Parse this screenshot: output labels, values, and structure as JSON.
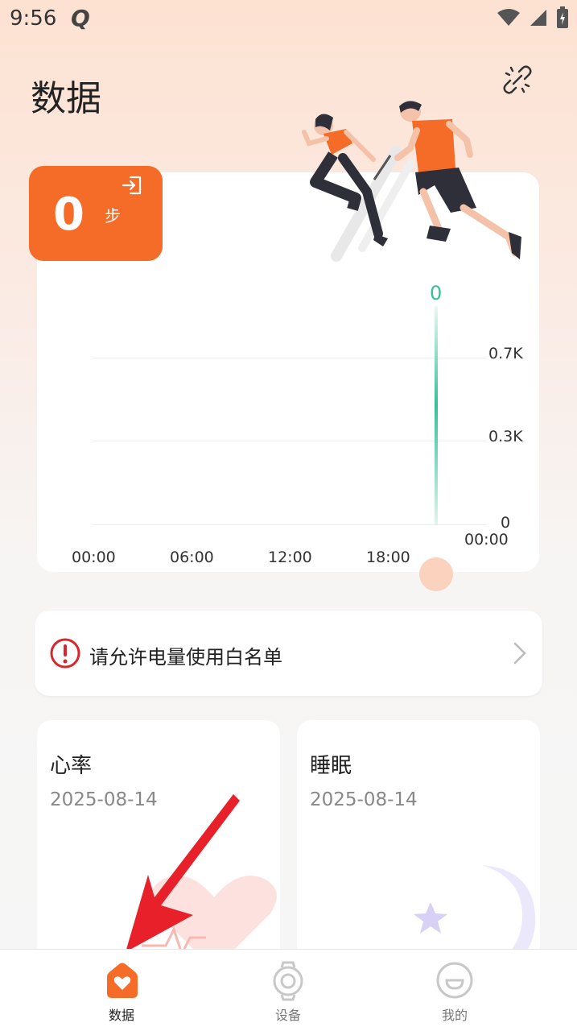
{
  "status": {
    "time": "9:56",
    "carrier_glyph": "Q"
  },
  "header": {
    "title": "数据"
  },
  "steps": {
    "value": "0",
    "unit": "步"
  },
  "chart_data": {
    "type": "bar",
    "x_ticks": [
      "00:00",
      "06:00",
      "12:00",
      "18:00",
      "00:00"
    ],
    "y_ticks": [
      "0.7K",
      "0.3K",
      "0"
    ],
    "values": [
      0
    ],
    "value_label": "0",
    "color": "#33c196"
  },
  "alert": {
    "text": "请允许电量使用白名单"
  },
  "tiles": [
    {
      "title": "心率",
      "date": "2025-08-14"
    },
    {
      "title": "睡眠",
      "date": "2025-08-14"
    }
  ],
  "nav": [
    {
      "label": "数据",
      "icon": "home-heart-icon",
      "active": true
    },
    {
      "label": "设备",
      "icon": "watch-icon",
      "active": false
    },
    {
      "label": "我的",
      "icon": "face-icon",
      "active": false
    }
  ],
  "colors": {
    "accent": "#f56b28",
    "chart": "#33c196",
    "arrow": "#e8202a"
  }
}
